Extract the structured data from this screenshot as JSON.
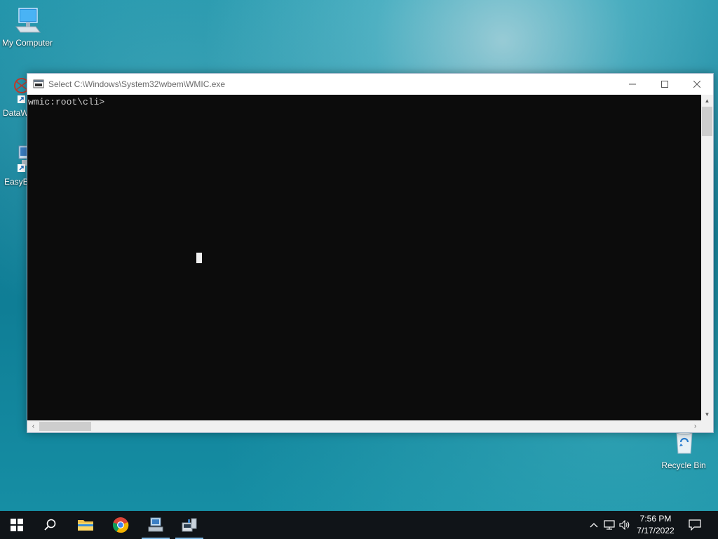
{
  "desktop": {
    "icons": [
      {
        "label": "My Computer",
        "icon": "computer-icon"
      },
      {
        "label": "DataW",
        "icon": "datawarrior-shortcut-icon"
      },
      {
        "label": "EasyB",
        "icon": "easybuilder-shortcut-icon"
      },
      {
        "label": "Recycle Bin",
        "icon": "recycle-bin-icon"
      }
    ]
  },
  "window": {
    "title": "Select C:\\Windows\\System32\\wbem\\WMIC.exe",
    "controls": {
      "minimize": "minimize-icon",
      "maximize": "maximize-icon",
      "close": "close-icon"
    },
    "console_lines": [
      "wmic:root\\cli>"
    ]
  },
  "taskbar": {
    "apps": [
      "start-icon",
      "search-icon",
      "file-explorer-icon",
      "chrome-icon",
      "computer-app-icon",
      "wmic-app-icon"
    ],
    "tray_icons": [
      "chevron-up-icon",
      "network-icon",
      "volume-icon"
    ],
    "time": "7:56 PM",
    "date": "7/17/2022",
    "notification_icon": "notification-icon"
  },
  "colors": {
    "accent": "#7fb9e6",
    "console_bg": "#0c0c0c",
    "console_text": "#cfcfcf",
    "taskbar_bg": "#101418"
  }
}
